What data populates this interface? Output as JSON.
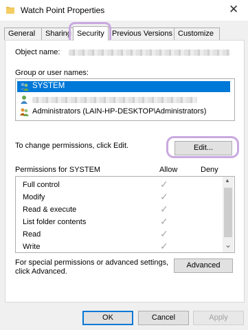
{
  "window": {
    "title": "Watch Point Properties",
    "close_glyph": "✕"
  },
  "tabs": [
    {
      "label": "General"
    },
    {
      "label": "Sharing"
    },
    {
      "label": "Security"
    },
    {
      "label": "Previous Versions"
    },
    {
      "label": "Customize"
    }
  ],
  "security": {
    "object_name_label": "Object name:",
    "groups_label": "Group or user names:",
    "users": [
      {
        "name": "SYSTEM",
        "icon": "group-users-icon"
      },
      {
        "name": "",
        "icon": "user-icon"
      },
      {
        "name": "Administrators (LAIN-HP-DESKTOP\\Administrators)",
        "icon": "group-users-icon"
      }
    ],
    "change_text": "To change permissions, click Edit.",
    "edit_button": "Edit...",
    "permissions_label": "Permissions for SYSTEM",
    "allow_header": "Allow",
    "deny_header": "Deny",
    "permissions": [
      {
        "name": "Full control",
        "allow": "✓"
      },
      {
        "name": "Modify",
        "allow": "✓"
      },
      {
        "name": "Read & execute",
        "allow": "✓"
      },
      {
        "name": "List folder contents",
        "allow": "✓"
      },
      {
        "name": "Read",
        "allow": "✓"
      },
      {
        "name": "Write",
        "allow": "✓"
      }
    ],
    "scroll_up": "▲",
    "scroll_down": "⌄",
    "advanced_text_1": "For special permissions or advanced settings,",
    "advanced_text_2": "click Advanced.",
    "advanced_button": "Advanced"
  },
  "footer": {
    "ok": "OK",
    "cancel": "Cancel",
    "apply": "Apply"
  },
  "colors": {
    "selection": "#0078d7",
    "highlight_annotation": "#c9a8e0"
  }
}
